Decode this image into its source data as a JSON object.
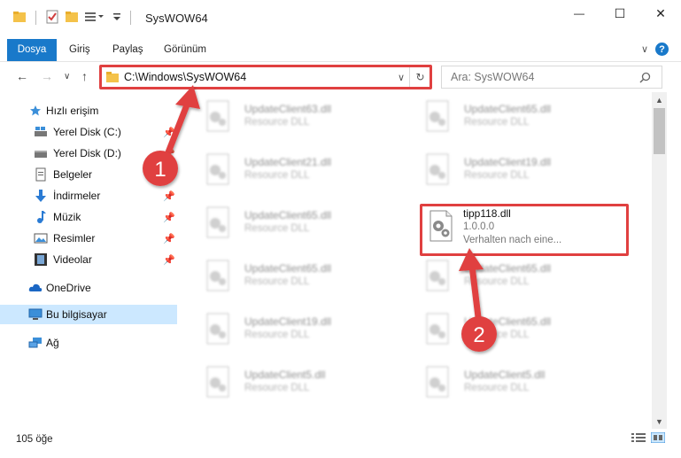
{
  "window": {
    "title": "SysWOW64",
    "minimize": "—",
    "maximize": "☐",
    "close": "✕"
  },
  "ribbon": {
    "tabs": [
      "Dosya",
      "Giriş",
      "Paylaş",
      "Görünüm"
    ],
    "expand": "∨",
    "help": "?"
  },
  "nav": {
    "back": "←",
    "forward": "→",
    "recent": "∨",
    "up": "↑",
    "address": "C:\\Windows\\SysWOW64",
    "address_dropdown": "∨",
    "refresh": "↻",
    "search_placeholder": "Ara: SysWOW64"
  },
  "sidebar": {
    "items": [
      {
        "label": "Hızlı erişim",
        "icon": "star-icon",
        "pinned": false
      },
      {
        "label": "Yerel Disk (C:)",
        "icon": "drive-icon",
        "pinned": true
      },
      {
        "label": "Yerel Disk (D:)",
        "icon": "drive-icon",
        "pinned": true
      },
      {
        "label": "Belgeler",
        "icon": "document-icon",
        "pinned": true
      },
      {
        "label": "İndirmeler",
        "icon": "download-icon",
        "pinned": true
      },
      {
        "label": "Müzik",
        "icon": "music-icon",
        "pinned": true
      },
      {
        "label": "Resimler",
        "icon": "pictures-icon",
        "pinned": true
      },
      {
        "label": "Videolar",
        "icon": "video-icon",
        "pinned": true
      },
      {
        "label": "OneDrive",
        "icon": "cloud-icon",
        "pinned": false
      },
      {
        "label": "Bu bilgisayar",
        "icon": "computer-icon",
        "pinned": false,
        "selected": true
      },
      {
        "label": "Ağ",
        "icon": "network-icon",
        "pinned": false
      }
    ]
  },
  "files": [
    {
      "name": "UpdateClient63.dll",
      "type": "Resource DLL"
    },
    {
      "name": "UpdateClient65.dll",
      "type": "Resource DLL"
    },
    {
      "name": "UpdateClient21.dll",
      "type": "Resource DLL"
    },
    {
      "name": "UpdateClient19.dll",
      "type": "Resource DLL"
    },
    {
      "name": "UpdateClient65.dll",
      "type": "Resource DLL"
    },
    {
      "name": "tipp118.dll",
      "type": "1.0.0.0",
      "description": "Verhalten nach eine...",
      "highlighted": true
    },
    {
      "name": "UpdateClient65.dll",
      "type": "Resource DLL"
    },
    {
      "name": "UpdateClient65.dll",
      "type": "Resource DLL"
    },
    {
      "name": "UpdateClient19.dll",
      "type": "Resource DLL"
    },
    {
      "name": "UpdateClient65.dll",
      "type": "Resource DLL"
    },
    {
      "name": "UpdateClient5.dll",
      "type": "Resource DLL"
    },
    {
      "name": "UpdateClient5.dll",
      "type": "Resource DLL"
    }
  ],
  "status": {
    "item_count": "105 öğe"
  },
  "annotations": {
    "step1": "1",
    "step2": "2",
    "color": "#e04040"
  }
}
